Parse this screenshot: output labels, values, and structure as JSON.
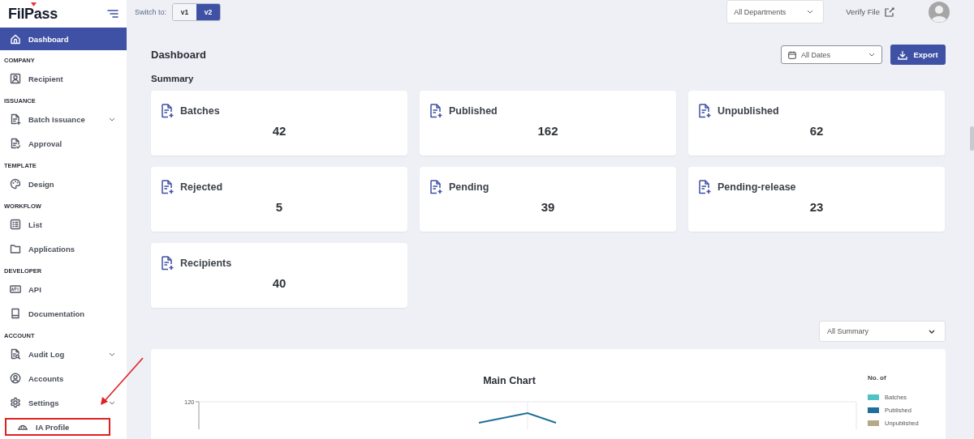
{
  "logo": {
    "text": "FilPass"
  },
  "sidebar": {
    "top_item": {
      "label": "Dashboard",
      "selected": true,
      "expandable": false
    },
    "sections": [
      {
        "title": "COMPANY",
        "items": [
          {
            "label": "Recipient",
            "selected": false,
            "expandable": false
          }
        ]
      },
      {
        "title": "ISSUANCE",
        "items": [
          {
            "label": "Batch Issuance",
            "selected": false,
            "expandable": true
          },
          {
            "label": "Approval",
            "selected": false,
            "expandable": false
          }
        ]
      },
      {
        "title": "TEMPLATE",
        "items": [
          {
            "label": "Design",
            "selected": false,
            "expandable": false
          }
        ]
      },
      {
        "title": "WORKFLOW",
        "items": [
          {
            "label": "List",
            "selected": false,
            "expandable": false
          },
          {
            "label": "Applications",
            "selected": false,
            "expandable": false
          }
        ]
      },
      {
        "title": "DEVELOPER",
        "items": [
          {
            "label": "API",
            "selected": false,
            "expandable": false
          },
          {
            "label": "Documentation",
            "selected": false,
            "expandable": false
          }
        ]
      },
      {
        "title": "ACCOUNT",
        "items": [
          {
            "label": "Audit Log",
            "selected": false,
            "expandable": true
          },
          {
            "label": "Accounts",
            "selected": false,
            "expandable": false
          },
          {
            "label": "Settings",
            "selected": false,
            "expandable": true,
            "children": [
              {
                "label": "IA Profile",
                "selected": false,
                "highlighted": true
              }
            ]
          }
        ]
      }
    ]
  },
  "topbar": {
    "switch_label": "Switch to:",
    "versions": [
      {
        "label": "v1",
        "selected": false
      },
      {
        "label": "v2",
        "selected": true
      }
    ],
    "department_select": {
      "value": "All Departments"
    },
    "verify_link": "Verify File"
  },
  "page": {
    "title": "Dashboard",
    "date_select": {
      "value": "All Dates"
    },
    "export_button": "Export",
    "summary_title": "Summary",
    "cards": [
      {
        "label": "Batches",
        "value": "42"
      },
      {
        "label": "Published",
        "value": "162"
      },
      {
        "label": "Unpublished",
        "value": "62"
      },
      {
        "label": "Rejected",
        "value": "5"
      },
      {
        "label": "Pending",
        "value": "39"
      },
      {
        "label": "Pending-release",
        "value": "23"
      },
      {
        "label": "Recipients",
        "value": "40"
      }
    ],
    "summary_select": {
      "value": "All Summary"
    },
    "chart": {
      "title": "Main Chart",
      "y_tick": "120",
      "legend_title": "No. of",
      "legend": [
        {
          "label": "Batches",
          "color": "#4fc3c3"
        },
        {
          "label": "Published",
          "color": "#1f6f9a"
        },
        {
          "label": "Unpublished",
          "color": "#b5a98a"
        }
      ]
    }
  }
}
